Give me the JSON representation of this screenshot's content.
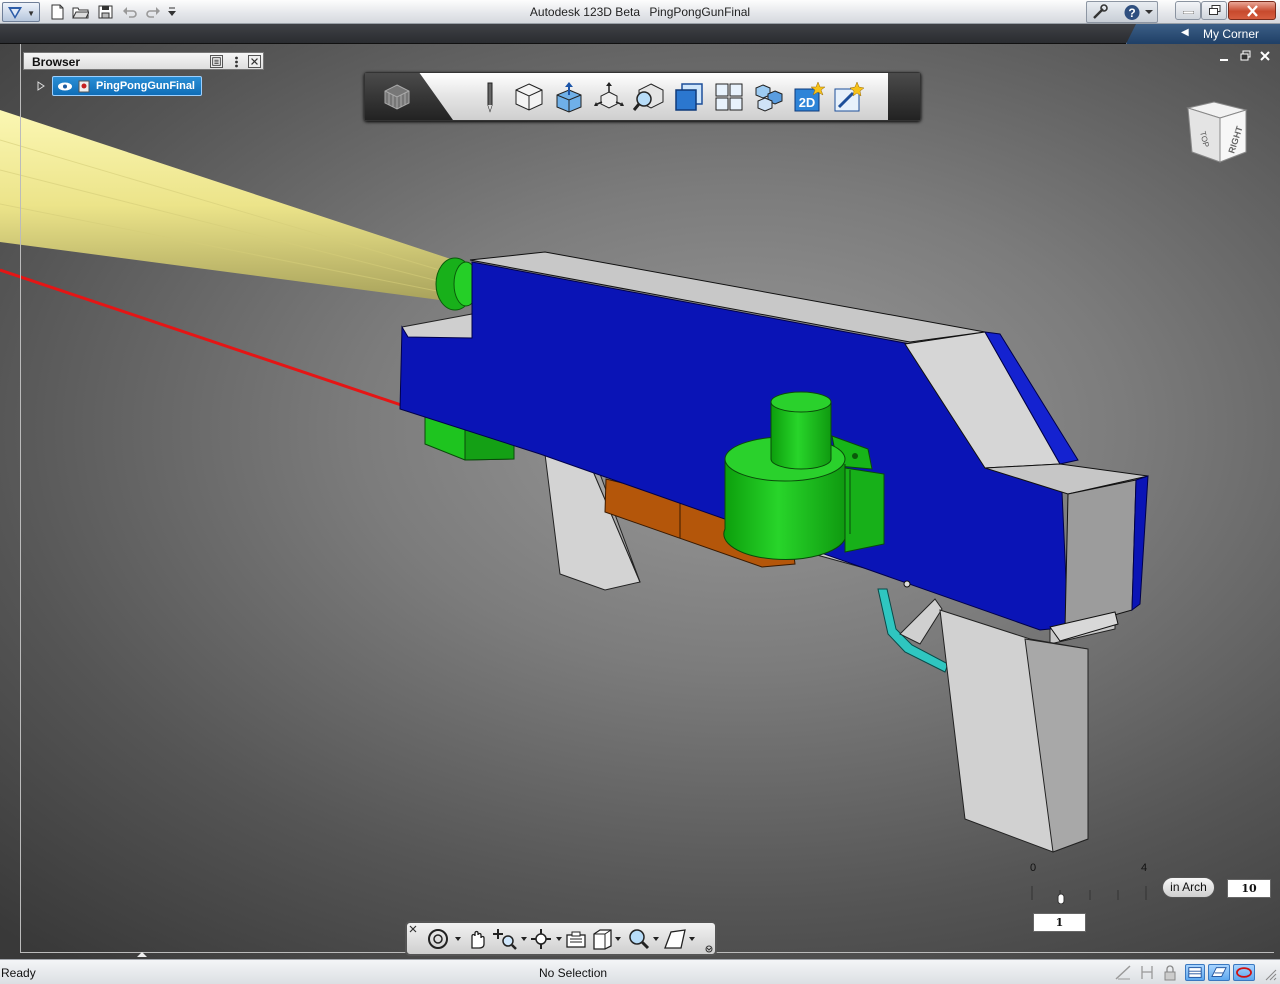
{
  "window": {
    "app_name": "Autodesk 123D Beta",
    "document_name": "PingPongGunFinal"
  },
  "header": {
    "my_corner_label": "My Corner"
  },
  "browser": {
    "title": "Browser",
    "tree": [
      {
        "label": "PingPongGunFinal",
        "selected": true
      }
    ]
  },
  "toolbar": {
    "buttons": [
      {
        "id": "sketch",
        "icon": "pencil-icon"
      },
      {
        "id": "primitives",
        "icon": "box-icon"
      },
      {
        "id": "construct",
        "icon": "extrude-icon"
      },
      {
        "id": "modify",
        "icon": "move-arrows-icon"
      },
      {
        "id": "inspect",
        "icon": "inspect-icon"
      },
      {
        "id": "combine",
        "icon": "combine-icon"
      },
      {
        "id": "pattern",
        "icon": "grid-pattern-icon"
      },
      {
        "id": "components",
        "icon": "cubes-icon"
      },
      {
        "id": "drawing-2d",
        "icon": "2d-drawing-icon",
        "label": "2D"
      },
      {
        "id": "make",
        "icon": "sparkle-icon"
      }
    ]
  },
  "viewcube": {
    "faces": [
      "TOP",
      "RIGHT"
    ]
  },
  "ruler": {
    "min_label": "0",
    "max_label": "4",
    "units": "in Arch",
    "grid_value": "10",
    "snap_value": "1"
  },
  "status": {
    "left": "Ready",
    "center": "No Selection"
  },
  "colors": {
    "body": "#0a14b6",
    "body_top": "#c8c8c8",
    "green_parts": "#19c21a",
    "orange_part": "#b25608",
    "trigger_guard": "#2fc6c0",
    "beam": "#f4f09a",
    "laser": "#e51515",
    "selection": "#1479c6"
  }
}
